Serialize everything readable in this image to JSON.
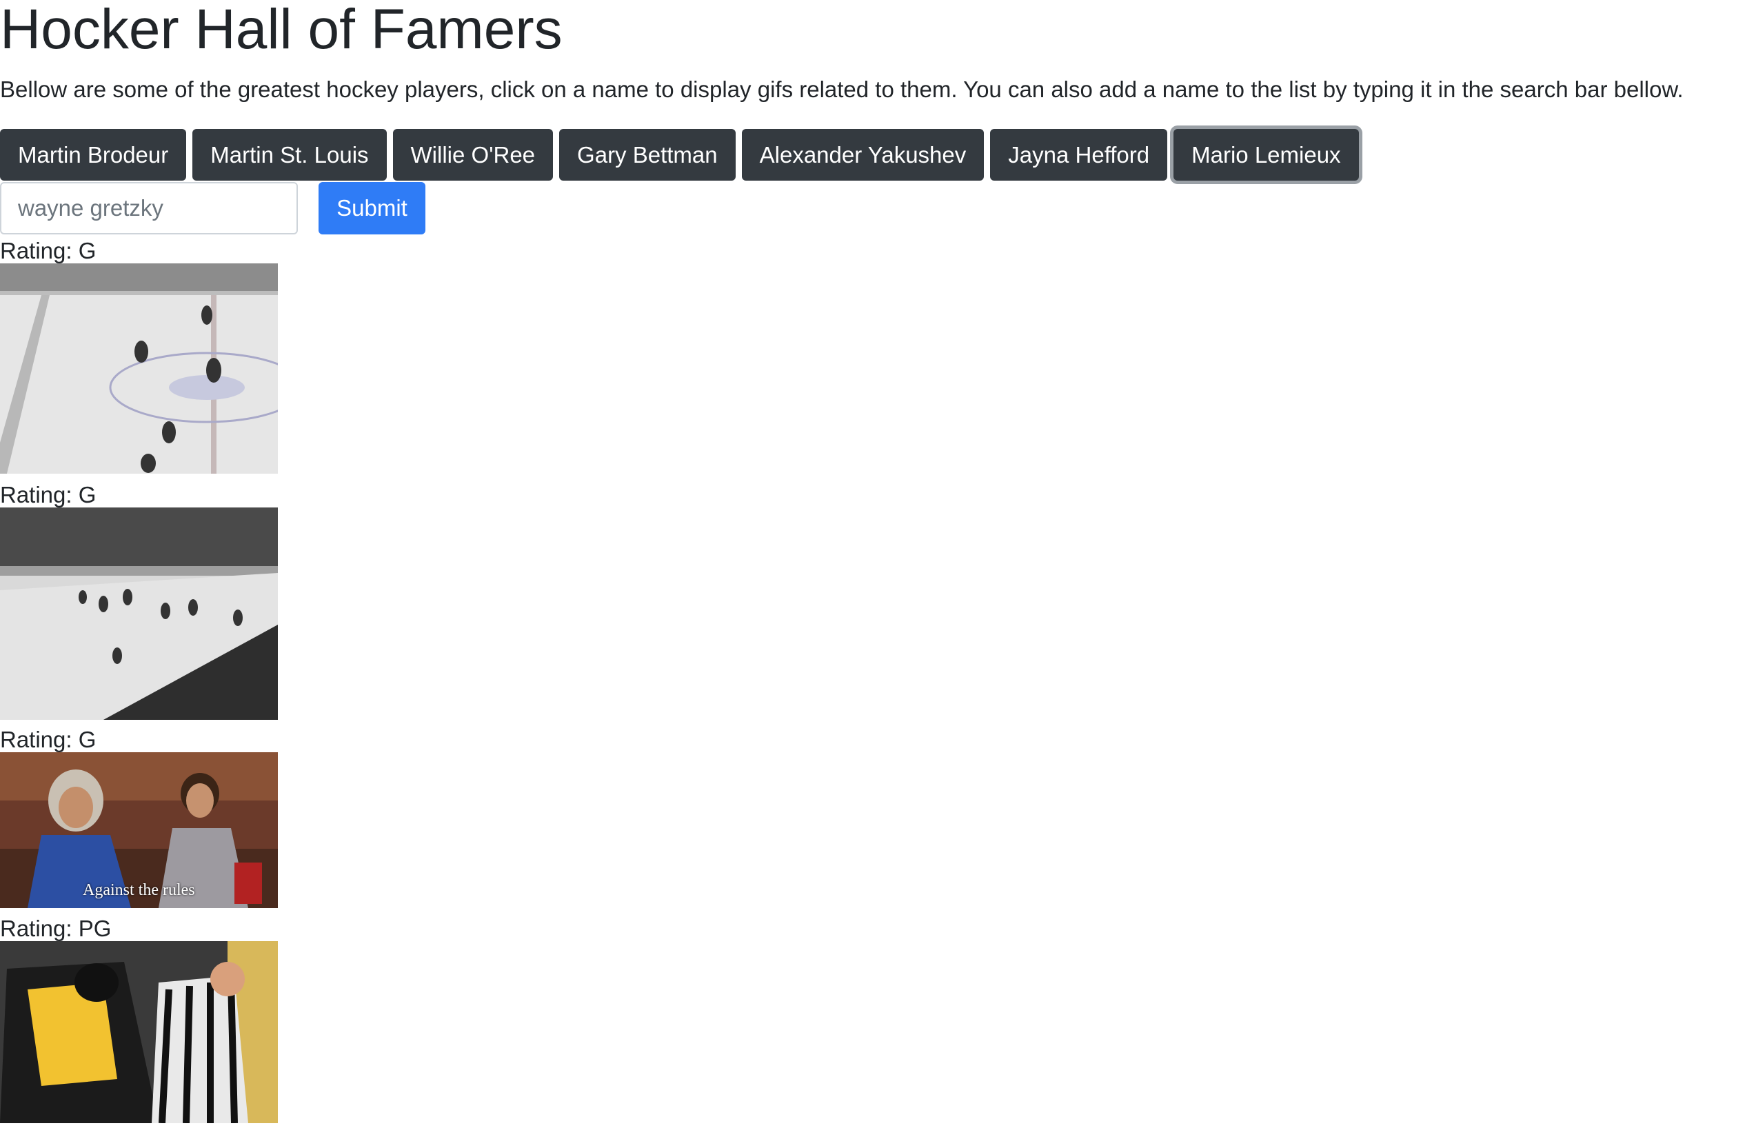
{
  "header": {
    "title": "Hocker Hall of Famers",
    "intro": "Bellow are some of the greatest hockey players, click on a name to display gifs related to them. You can also add a name to the list by typing it in the search bar bellow."
  },
  "players": [
    {
      "label": "Martin Brodeur"
    },
    {
      "label": "Martin St. Louis"
    },
    {
      "label": "Willie O'Ree"
    },
    {
      "label": "Gary Bettman"
    },
    {
      "label": "Alexander Yakushev"
    },
    {
      "label": "Jayna Hefford"
    },
    {
      "label": "Mario Lemieux"
    }
  ],
  "search": {
    "value": "",
    "placeholder": "wayne gretzky",
    "submit_label": "Submit"
  },
  "gifs": [
    {
      "rating": "Rating: G",
      "caption": ""
    },
    {
      "rating": "Rating: G",
      "caption": ""
    },
    {
      "rating": "Rating: G",
      "caption": "Against the rules"
    },
    {
      "rating": "Rating: PG",
      "caption": ""
    }
  ],
  "colors": {
    "player_button_bg": "#343a40",
    "submit_button_bg": "#2f7cf6",
    "text": "#212529"
  }
}
